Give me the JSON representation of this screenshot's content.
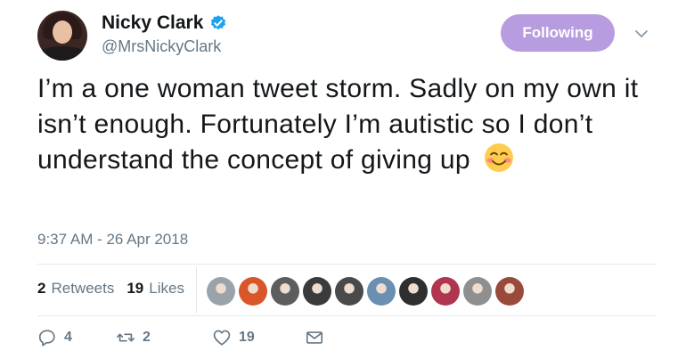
{
  "author": {
    "display_name": "Nicky Clark",
    "handle": "@MrsNickyClark",
    "verified": true
  },
  "follow_button": {
    "label": "Following",
    "color": "#b79cdf"
  },
  "tweet": {
    "text": "I’m a one woman tweet storm. Sadly on my own it isn’t enough. Fortunately I’m autistic so I don’t understand the concept of giving up",
    "emoji": "smiling-face-with-blush-emoji",
    "timestamp": "9:37 AM - 26 Apr 2018"
  },
  "stats": {
    "retweets_count": "2",
    "retweets_label": "Retweets",
    "likes_count": "19",
    "likes_label": "Likes"
  },
  "likers": [
    {
      "icon": "liker-avatar-1",
      "color": "#9aa3aa"
    },
    {
      "icon": "liker-avatar-2",
      "color": "#d9562b"
    },
    {
      "icon": "liker-avatar-3",
      "color": "#5d5d5d"
    },
    {
      "icon": "liker-avatar-4",
      "color": "#3b3b3b"
    },
    {
      "icon": "liker-avatar-5",
      "color": "#4a4a4a"
    },
    {
      "icon": "liker-avatar-6",
      "color": "#6b8fb0"
    },
    {
      "icon": "liker-avatar-7",
      "color": "#2f2f2f"
    },
    {
      "icon": "liker-avatar-8",
      "color": "#b0364f"
    },
    {
      "icon": "liker-avatar-9",
      "color": "#8f8f8f"
    },
    {
      "icon": "liker-avatar-10",
      "color": "#9a4a3a"
    }
  ],
  "actions": {
    "reply_count": "4",
    "retweet_count": "2",
    "like_count": "19"
  },
  "colors": {
    "text": "#14171a",
    "muted": "#657786",
    "verified": "#1da1f2",
    "divider": "#e1e8ed"
  }
}
